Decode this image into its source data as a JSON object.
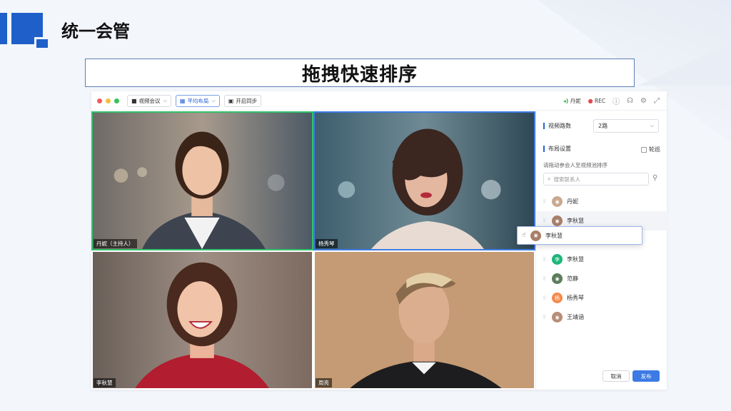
{
  "slide": {
    "section_title": "统一会管",
    "banner_title": "拖拽快速排序"
  },
  "toolbar": {
    "meeting_label": "视频会议",
    "layout_label": "平均布局",
    "sync_label": "开启同步",
    "speaker_label": "丹妮",
    "rec_label": "REC",
    "window_dots": [
      "#f15b5b",
      "#f6bd41",
      "#36c35a"
    ]
  },
  "video_tiles": [
    {
      "label": "丹妮（主持人）",
      "border": "green"
    },
    {
      "label": "杨秀琴",
      "border": "blue"
    },
    {
      "label": "李秋慧",
      "border": "none"
    },
    {
      "label": "周亮",
      "border": "none"
    }
  ],
  "panel": {
    "video_routes_label": "视频路数",
    "video_routes_value": "2路",
    "layout_settings_label": "布局设置",
    "carousel_label": "轮巡",
    "hint": "请拖动参会人至视频池排序",
    "search_placeholder": "搜索联系人",
    "participants": [
      {
        "name": "丹妮",
        "avatar": "photo",
        "initial": ""
      },
      {
        "name": "李秋慧",
        "avatar": "photo",
        "initial": ""
      },
      {
        "name": "李秋慧",
        "avatar": "initial",
        "initial": "李",
        "color": "#1fb57a"
      },
      {
        "name": "范静",
        "avatar": "photo",
        "initial": ""
      },
      {
        "name": "杨秀琴",
        "avatar": "initial",
        "initial": "杨",
        "color": "#f5894a"
      },
      {
        "name": "王靖涵",
        "avatar": "photo",
        "initial": ""
      }
    ],
    "dragging_name": "李秋慧",
    "cancel_label": "取消",
    "publish_label": "发布"
  },
  "colors": {
    "accent": "#3d7be4",
    "host_border": "#2fc26b",
    "brand_blue": "#1f5fc9"
  }
}
